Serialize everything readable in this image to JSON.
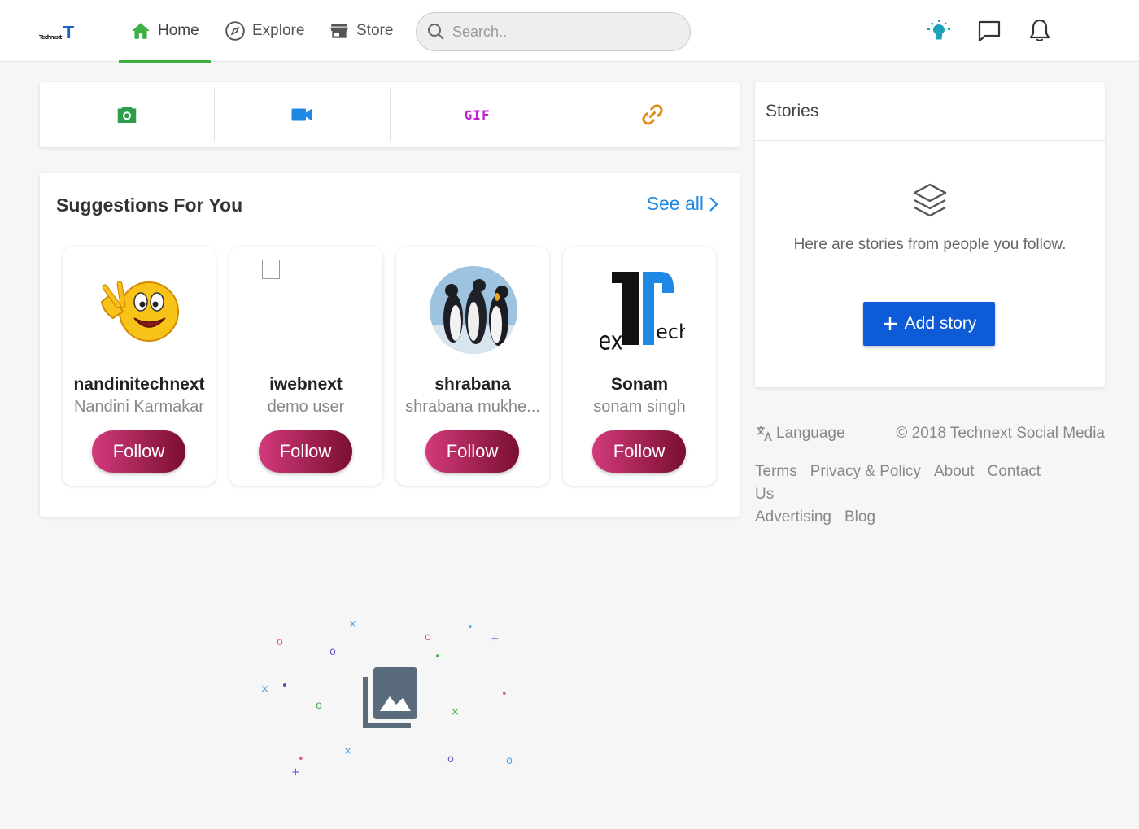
{
  "nav": {
    "logo_small": "Technext",
    "logo_big": "T",
    "items": [
      {
        "label": "Home",
        "active": true
      },
      {
        "label": "Explore",
        "active": false
      },
      {
        "label": "Store",
        "active": false
      }
    ],
    "search_placeholder": "Search..",
    "icons": [
      "bulb-icon",
      "message-icon",
      "bell-icon"
    ]
  },
  "post_bar": {
    "tools": [
      "camera-icon",
      "video-icon",
      "gif-icon",
      "link-icon"
    ],
    "gif_label": "GIF"
  },
  "suggestions": {
    "title": "Suggestions For You",
    "see_all": "See all",
    "follow_label": "Follow",
    "users": [
      {
        "username": "nandinitechnext",
        "name": "Nandini Karmakar"
      },
      {
        "username": "iwebnext",
        "name": "demo user"
      },
      {
        "username": "shrabana",
        "name": "shrabana mukhe..."
      },
      {
        "username": "Sonam",
        "name": "sonam singh"
      }
    ]
  },
  "stories": {
    "title": "Stories",
    "empty_text": "Here are stories from people you follow.",
    "add_label": "Add story"
  },
  "footer": {
    "language": "Language",
    "copyright": "© 2018 Technext Social Media",
    "links": [
      "Terms",
      "Privacy & Policy",
      "About",
      "Contact Us",
      "Advertising",
      "Blog"
    ]
  },
  "colors": {
    "accent_green": "#3cb043",
    "link_blue": "#1e88e5",
    "story_button": "#0d5bd7",
    "follow_gradient_start": "#d23a7c",
    "follow_gradient_end": "#7a0f30"
  }
}
